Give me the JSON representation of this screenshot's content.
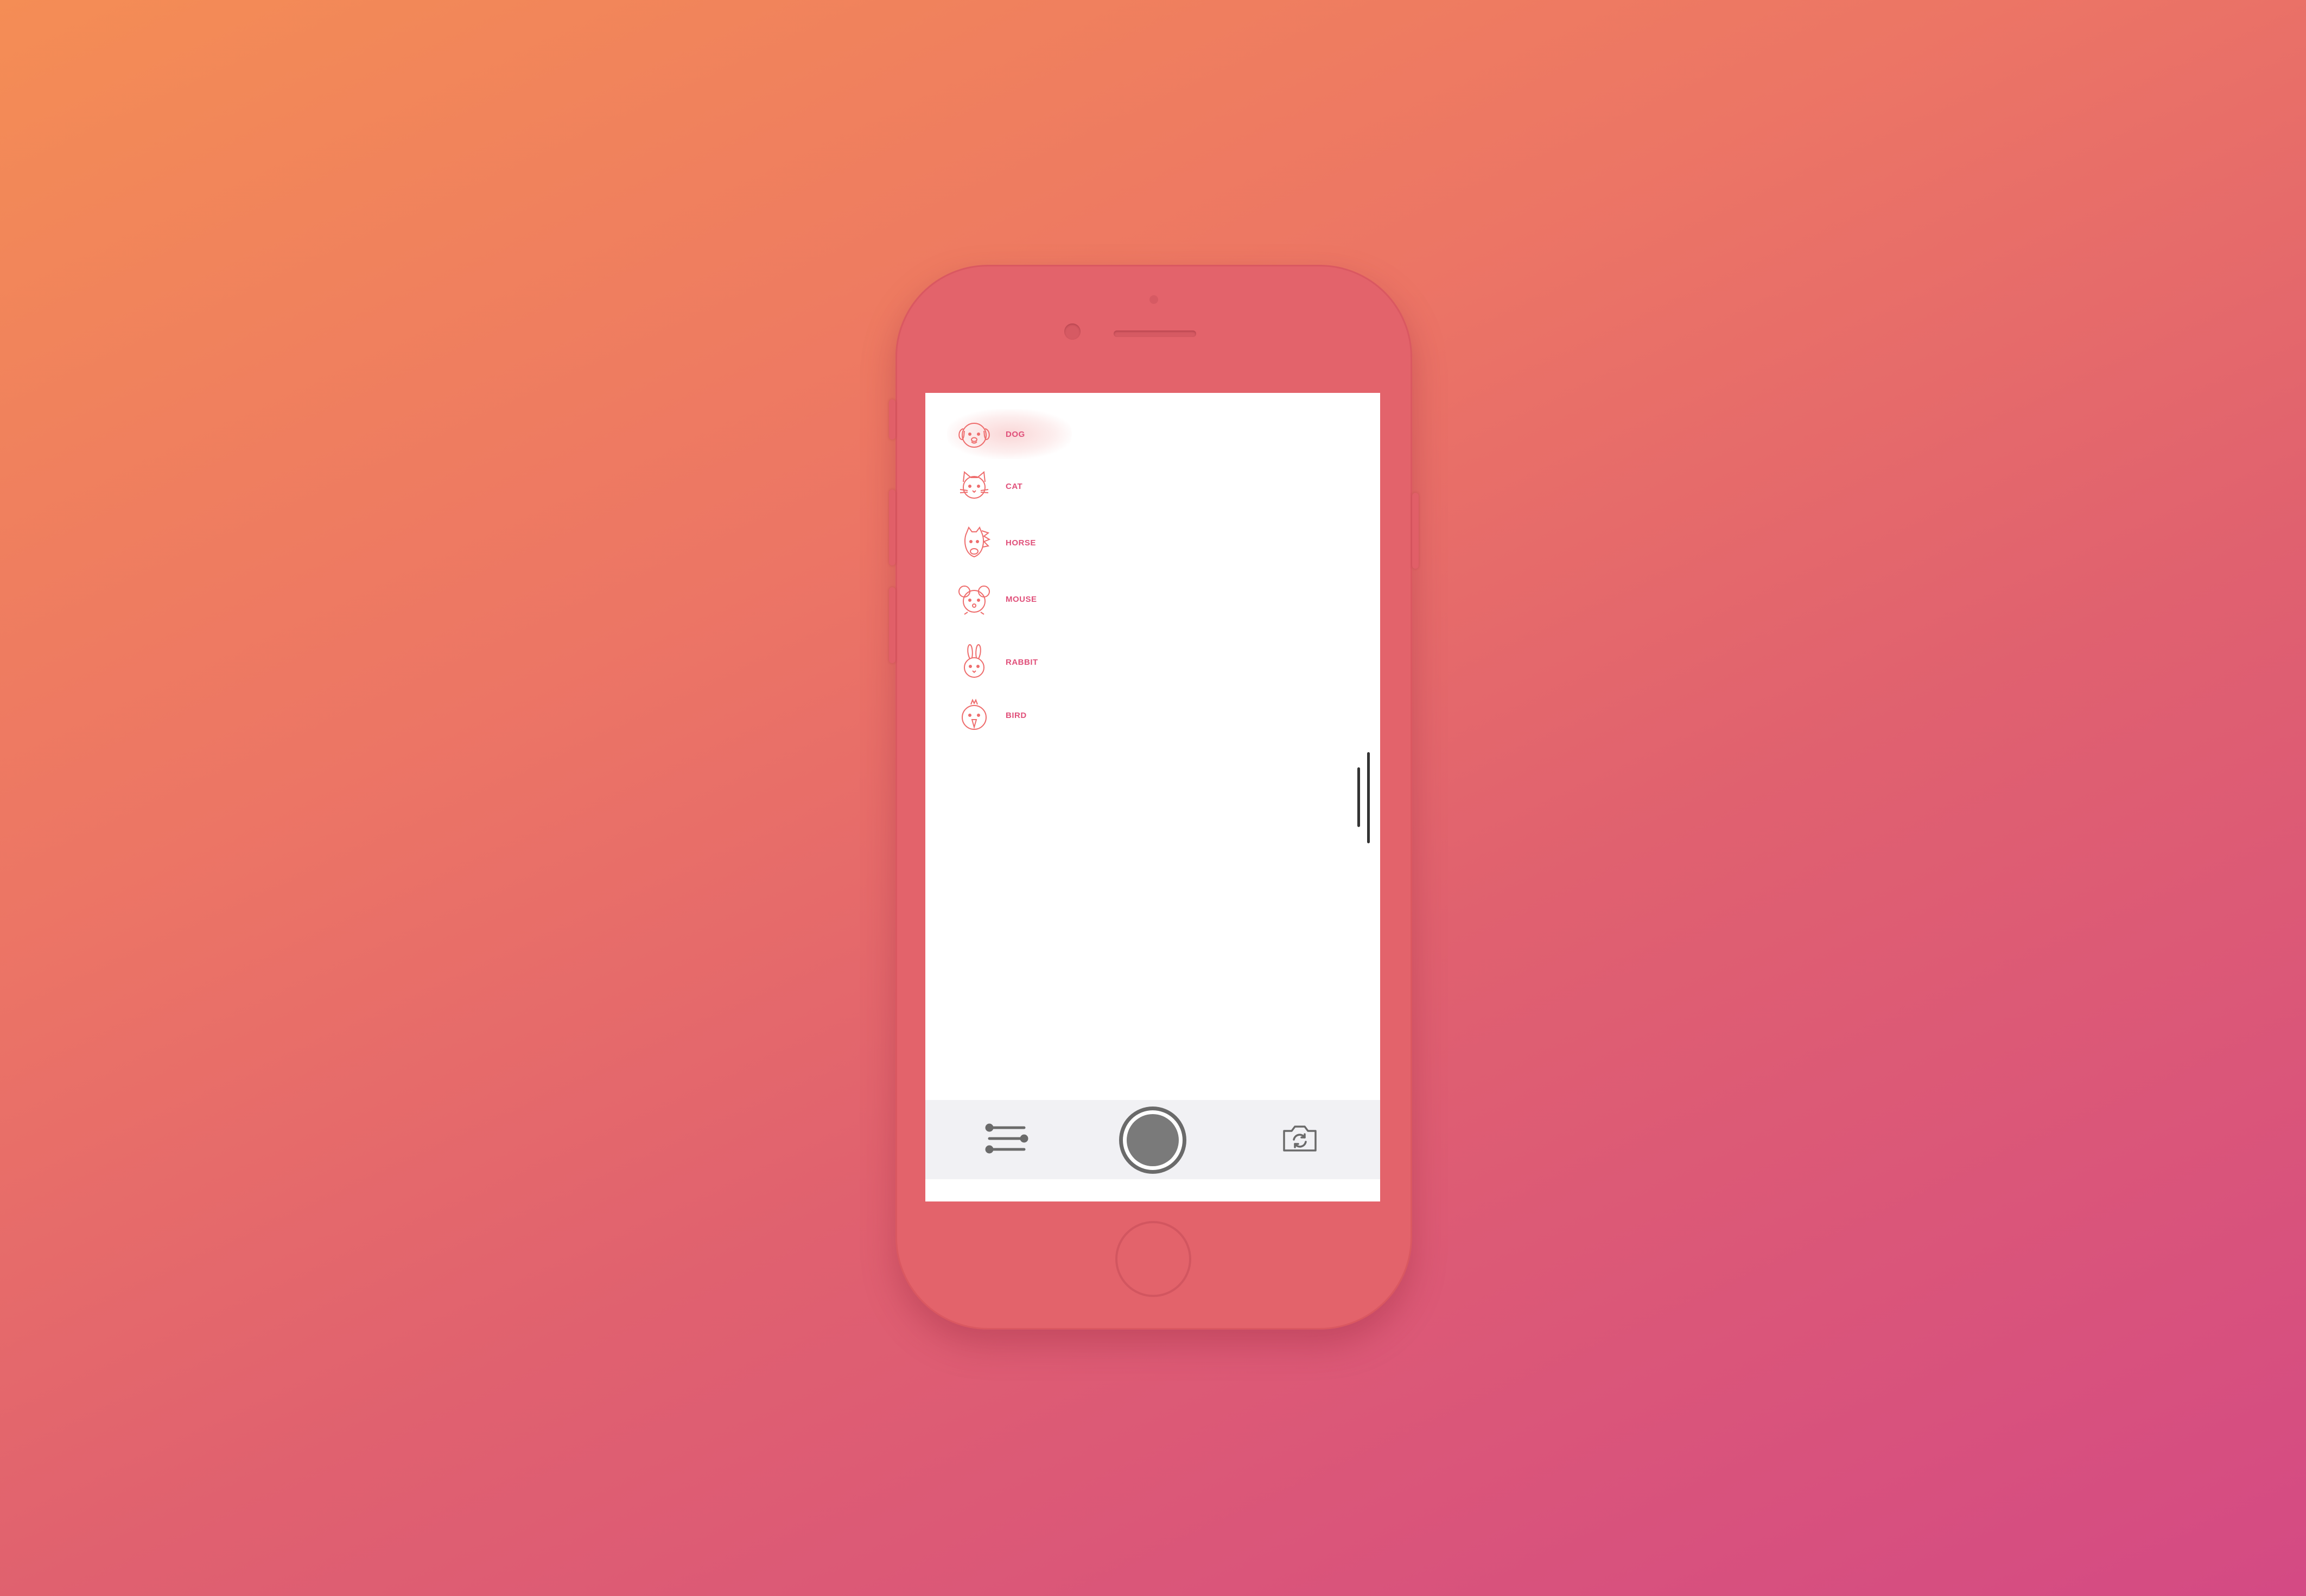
{
  "animals": [
    {
      "label": "DOG",
      "icon": "dog-icon",
      "selected": true
    },
    {
      "label": "CAT",
      "icon": "cat-icon",
      "selected": false
    },
    {
      "label": "HORSE",
      "icon": "horse-icon",
      "selected": false
    },
    {
      "label": "MOUSE",
      "icon": "mouse-icon",
      "selected": false
    },
    {
      "label": "RABBIT",
      "icon": "rabbit-icon",
      "selected": false
    },
    {
      "label": "BIRD",
      "icon": "bird-icon",
      "selected": false
    }
  ],
  "toolbar": {
    "settings_icon": "sliders-icon",
    "shutter_icon": "shutter-icon",
    "flip_icon": "camera-flip-icon"
  },
  "colors": {
    "accent": "#e0507a",
    "icon_stroke": "#ee6d6d",
    "phone_body": "#e3636b",
    "toolbar_bg": "#f1f1f4"
  }
}
